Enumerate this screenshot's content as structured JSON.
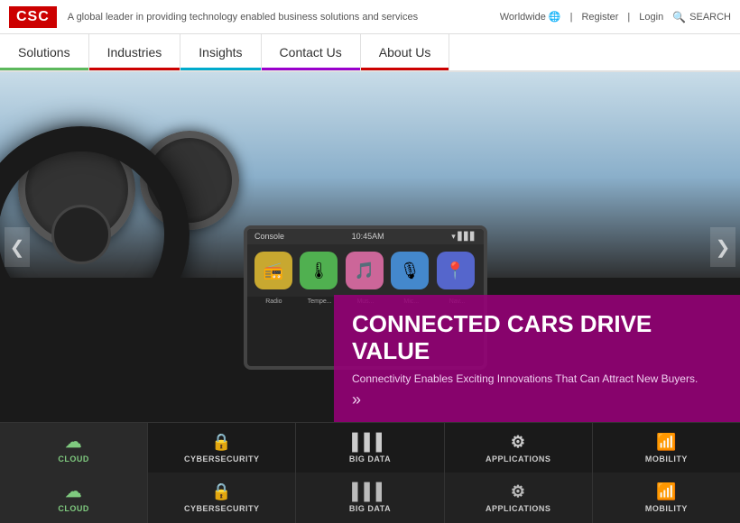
{
  "header": {
    "logo": "CSC",
    "tagline": "A global leader in providing technology enabled business solutions and services",
    "worldwide_label": "Worldwide",
    "register_label": "Register",
    "login_label": "Login",
    "search_label": "SEARCH"
  },
  "nav": {
    "items": [
      {
        "label": "Solutions",
        "class": "nav-solutions"
      },
      {
        "label": "Industries",
        "class": "nav-industries"
      },
      {
        "label": "Insights",
        "class": "nav-insights"
      },
      {
        "label": "Contact Us",
        "class": "nav-contact"
      },
      {
        "label": "About Us",
        "class": "nav-about"
      }
    ]
  },
  "hero": {
    "title": "CONNECTED CARS DRIVE VALUE",
    "subtitle": "Connectivity Enables Exciting Innovations That Can Attract New Buyers.",
    "more_icon": "»",
    "console": {
      "left_label": "Console",
      "center_label": "10:45AM",
      "apps": [
        {
          "icon": "📻",
          "label": "Radio",
          "class": "app-radio"
        },
        {
          "icon": "🌡",
          "label": "Tempe...",
          "class": "app-temp"
        },
        {
          "icon": "🎵",
          "label": "Mus...",
          "class": "app-music"
        },
        {
          "icon": "🎙",
          "label": "Mic...",
          "class": "app-mic"
        },
        {
          "icon": "📍",
          "label": "Nav...",
          "class": "app-map"
        }
      ]
    },
    "arrow_left": "❮",
    "arrow_right": "❯"
  },
  "bottom_bar_1": {
    "items": [
      {
        "icon": "☁",
        "label": "CLOUD",
        "active": true
      },
      {
        "icon": "🔒",
        "label": "CYBERSECURITY",
        "active": false
      },
      {
        "icon": "📊",
        "label": "BIG DATA",
        "active": false
      },
      {
        "icon": "⚙",
        "label": "APPLICATIONS",
        "active": false
      },
      {
        "icon": "📶",
        "label": "MOBILITY",
        "active": false
      }
    ]
  },
  "bottom_bar_2": {
    "items": [
      {
        "icon": "☁",
        "label": "CLOUD",
        "active": true
      },
      {
        "icon": "🔒",
        "label": "CYBERSECURITY",
        "active": false
      },
      {
        "icon": "📊",
        "label": "BIG DATA",
        "active": false
      },
      {
        "icon": "⚙",
        "label": "APPLICATIONS",
        "active": false
      },
      {
        "icon": "📶",
        "label": "MOBILITY",
        "active": false
      }
    ]
  }
}
